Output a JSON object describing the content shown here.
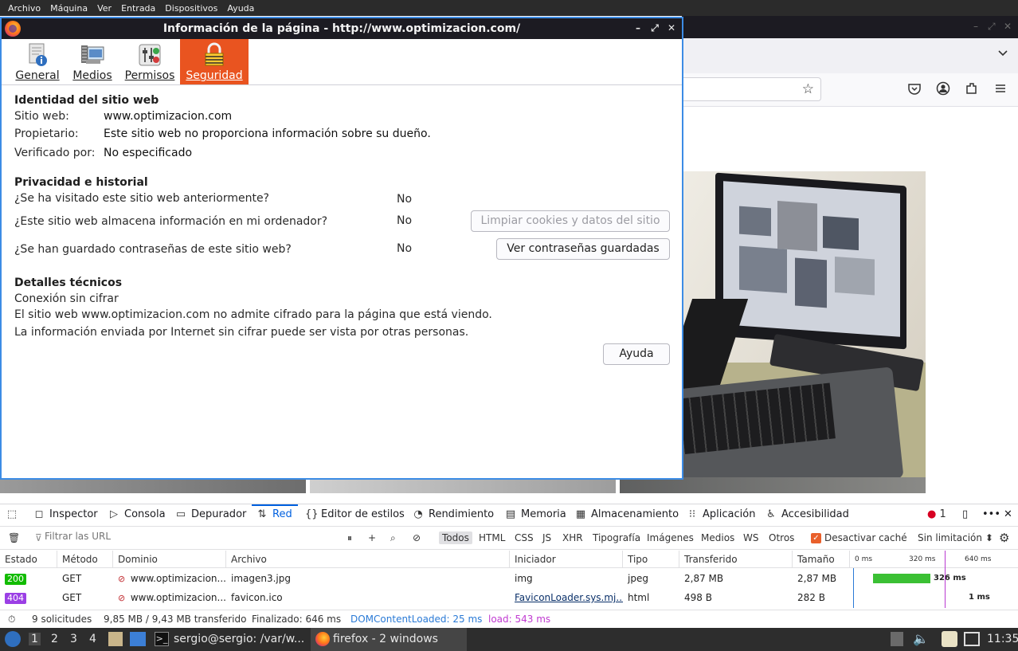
{
  "vm_menubar": {
    "items": [
      "Archivo",
      "Máquina",
      "Ver",
      "Entrada",
      "Dispositivos",
      "Ayuda"
    ]
  },
  "dialog": {
    "title": "Información de la página - http://www.optimizacion.com/",
    "tabs": [
      {
        "label": "General",
        "icon": "info-page-icon",
        "active": false
      },
      {
        "label": "Medios",
        "icon": "media-icon",
        "active": false
      },
      {
        "label": "Permisos",
        "icon": "permissions-icon",
        "active": false
      },
      {
        "label": "Seguridad",
        "icon": "padlock-icon",
        "active": true
      }
    ],
    "identity": {
      "heading": "Identidad del sitio web",
      "website_label": "Sitio web:",
      "website_value": "www.optimizacion.com",
      "owner_label": "Propietario:",
      "owner_value": "Este sitio web no proporciona información sobre su dueño.",
      "verified_label": "Verificado por:",
      "verified_value": "No especificado"
    },
    "privacy": {
      "heading": "Privacidad e historial",
      "q1": "¿Se ha visitado este sitio web anteriormente?",
      "a1": "No",
      "q2": "¿Este sitio web almacena información en mi ordenador?",
      "a2": "No",
      "q3": "¿Se han guardado contraseñas de este sitio web?",
      "a3": "No",
      "clear_button": "Limpiar cookies y datos del sitio",
      "passwords_button": "Ver contraseñas guardadas"
    },
    "technical": {
      "heading": "Detalles técnicos",
      "line1": "Conexión sin cifrar",
      "line2": "El sitio web www.optimizacion.com no admite cifrado para la página que está viendo.",
      "line3": "La información enviada por Internet sin cifrar puede ser vista por otras personas."
    },
    "help_button": "Ayuda"
  },
  "devtools": {
    "tabs": [
      {
        "label": "Inspector",
        "icon": "inspector-icon"
      },
      {
        "label": "Consola",
        "icon": "console-icon"
      },
      {
        "label": "Depurador",
        "icon": "debugger-icon"
      },
      {
        "label": "Red",
        "icon": "network-icon",
        "active": true
      },
      {
        "label": "Editor de estilos",
        "icon": "style-editor-icon"
      },
      {
        "label": "Rendimiento",
        "icon": "performance-icon"
      },
      {
        "label": "Memoria",
        "icon": "memory-icon"
      },
      {
        "label": "Almacenamiento",
        "icon": "storage-icon"
      },
      {
        "label": "Aplicación",
        "icon": "application-icon"
      },
      {
        "label": "Accesibilidad",
        "icon": "accessibility-icon"
      }
    ],
    "error_count": "1",
    "filter_placeholder": "Filtrar las URL",
    "type_filters": [
      "Todos",
      "HTML",
      "CSS",
      "JS",
      "XHR",
      "Tipografía",
      "Imágenes",
      "Medios",
      "WS",
      "Otros"
    ],
    "disable_cache_label": "Desactivar caché",
    "throttling": "Sin limitación ⬍",
    "columns": [
      "Estado",
      "Método",
      "Dominio",
      "Archivo",
      "Iniciador",
      "Tipo",
      "Transferido",
      "Tamaño"
    ],
    "waterfall_ticks": [
      "0 ms",
      "320 ms",
      "640 ms"
    ],
    "requests": [
      {
        "status": "200",
        "method": "GET",
        "domain": "www.optimizacion....",
        "file": "imagen3.jpg",
        "initiator": "img",
        "type": "jpeg",
        "transferred": "2,87 MB",
        "size": "2,87 MB",
        "timing": "326 ms"
      },
      {
        "status": "404",
        "method": "GET",
        "domain": "www.optimizacion....",
        "file": "favicon.ico",
        "initiator": "FaviconLoader.sys.mj...",
        "type": "html",
        "transferred": "498 B",
        "size": "282 B",
        "timing": "1 ms"
      }
    ],
    "summary": {
      "requests": "9 solicitudes",
      "transferred": "9,85 MB / 9,43 MB transferido",
      "finished": "Finalizado: 646 ms",
      "dom": "DOMContentLoaded: 25 ms",
      "load": "load: 543 ms"
    }
  },
  "taskbar": {
    "workspaces": [
      "1",
      "2",
      "3",
      "4"
    ],
    "terminal_label": "sergio@sergio: /var/w...",
    "firefox_label": "firefox - 2 windows",
    "clock": "11:35"
  }
}
